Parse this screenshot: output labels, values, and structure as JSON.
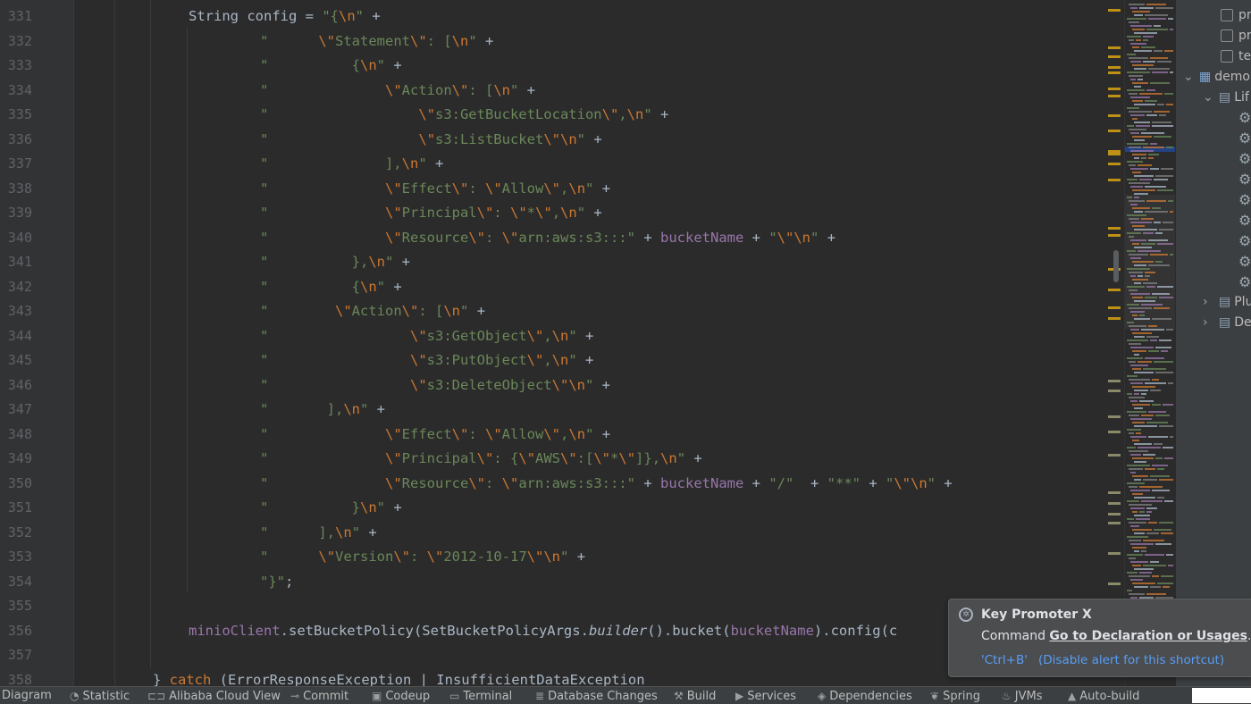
{
  "editor": {
    "lines": [
      {
        "n": "331",
        "segs": [
          [
            "",
            "String config = "
          ],
          [
            "str",
            "\"{"
          ],
          [
            "esc",
            "\\n"
          ],
          [
            "str",
            "\""
          ],
          [
            "",
            " +"
          ]
        ],
        "ind": 211
      },
      {
        "n": "332",
        "segs": [
          [
            "str",
            "\"      "
          ],
          [
            "esc",
            "\\\""
          ],
          [
            "str",
            "Statement"
          ],
          [
            "esc",
            "\\\""
          ],
          [
            "str",
            ": ["
          ],
          [
            "esc",
            "\\n"
          ],
          [
            "str",
            "\""
          ],
          [
            "",
            " +"
          ]
        ],
        "ind": 291
      },
      {
        "n": "333",
        "segs": [
          [
            "str",
            "\"          {"
          ],
          [
            "esc",
            "\\n"
          ],
          [
            "str",
            "\""
          ],
          [
            "",
            " +"
          ]
        ],
        "ind": 291
      },
      {
        "n": "334",
        "segs": [
          [
            "str",
            "\"              "
          ],
          [
            "esc",
            "\\\""
          ],
          [
            "str",
            "Action"
          ],
          [
            "esc",
            "\\\""
          ],
          [
            "str",
            ": ["
          ],
          [
            "esc",
            "\\n"
          ],
          [
            "str",
            "\""
          ],
          [
            "",
            " +"
          ]
        ],
        "ind": 291
      },
      {
        "n": "335",
        "segs": [
          [
            "str",
            "\"                  "
          ],
          [
            "esc",
            "\\\""
          ],
          [
            "str",
            "s3:GetBucketLocation"
          ],
          [
            "esc",
            "\\\""
          ],
          [
            "str",
            ","
          ],
          [
            "esc",
            "\\n"
          ],
          [
            "str",
            "\""
          ],
          [
            "",
            " +"
          ]
        ],
        "ind": 291
      },
      {
        "n": "336",
        "segs": [
          [
            "str",
            "\"                  "
          ],
          [
            "esc",
            "\\\""
          ],
          [
            "str",
            "s3:ListBucket"
          ],
          [
            "esc",
            "\\\""
          ],
          [
            "esc",
            "\\n"
          ],
          [
            "str",
            "\""
          ],
          [
            "",
            " +"
          ]
        ],
        "ind": 291
      },
      {
        "n": "337",
        "segs": [
          [
            "str",
            "\"              ],"
          ],
          [
            "esc",
            "\\n"
          ],
          [
            "str",
            "\""
          ],
          [
            "",
            " +"
          ]
        ],
        "ind": 291
      },
      {
        "n": "338",
        "segs": [
          [
            "str",
            "\"              "
          ],
          [
            "esc",
            "\\\""
          ],
          [
            "str",
            "Effect"
          ],
          [
            "esc",
            "\\\""
          ],
          [
            "str",
            ": "
          ],
          [
            "esc",
            "\\\""
          ],
          [
            "str",
            "Allow"
          ],
          [
            "esc",
            "\\\""
          ],
          [
            "str",
            ","
          ],
          [
            "esc",
            "\\n"
          ],
          [
            "str",
            "\""
          ],
          [
            "",
            " +"
          ]
        ],
        "ind": 291
      },
      {
        "n": "339",
        "segs": [
          [
            "str",
            "\"              "
          ],
          [
            "esc",
            "\\\""
          ],
          [
            "str",
            "Principal"
          ],
          [
            "esc",
            "\\\""
          ],
          [
            "str",
            ": "
          ],
          [
            "esc",
            "\\\""
          ],
          [
            "str",
            "*"
          ],
          [
            "esc",
            "\\\""
          ],
          [
            "str",
            ","
          ],
          [
            "esc",
            "\\n"
          ],
          [
            "str",
            "\""
          ],
          [
            "",
            " +"
          ]
        ],
        "ind": 291
      },
      {
        "n": "340",
        "segs": [
          [
            "str",
            "\"              "
          ],
          [
            "esc",
            "\\\""
          ],
          [
            "str",
            "Resource"
          ],
          [
            "esc",
            "\\\""
          ],
          [
            "str",
            ": "
          ],
          [
            "esc",
            "\\\""
          ],
          [
            "str",
            "arn:aws:s3:::"
          ],
          [
            "str",
            "\""
          ],
          [
            "",
            " + "
          ],
          [
            "fld",
            "bucketName"
          ],
          [
            "",
            " + "
          ],
          [
            "str",
            "\""
          ],
          [
            "esc",
            "\\\""
          ],
          [
            "esc",
            "\\n"
          ],
          [
            "str",
            "\""
          ],
          [
            "",
            " +"
          ]
        ],
        "ind": 291
      },
      {
        "n": "341",
        "segs": [
          [
            "str",
            "\"          },"
          ],
          [
            "esc",
            "\\n"
          ],
          [
            "str",
            "\""
          ],
          [
            "",
            " +"
          ]
        ],
        "ind": 291
      },
      {
        "n": "342",
        "segs": [
          [
            "str",
            "\"          {"
          ],
          [
            "esc",
            "\\n"
          ],
          [
            "str",
            "\""
          ],
          [
            "",
            " +"
          ]
        ],
        "ind": 291
      },
      {
        "n": "343",
        "segs": [
          [
            "str",
            "\"        "
          ],
          [
            "esc",
            "\\\""
          ],
          [
            "str",
            "Action"
          ],
          [
            "esc",
            "\\\""
          ],
          [
            "str",
            ": ["
          ],
          [
            "esc",
            "\\n"
          ],
          [
            "str",
            "\""
          ],
          [
            "",
            " +"
          ]
        ],
        "ind": 291
      },
      {
        "n": "344",
        "segs": [
          [
            "str",
            "\"                 "
          ],
          [
            "esc",
            "\\\""
          ],
          [
            "str",
            "s3:GetObject"
          ],
          [
            "esc",
            "\\\""
          ],
          [
            "str",
            ","
          ],
          [
            "esc",
            "\\n"
          ],
          [
            "str",
            "\""
          ],
          [
            "",
            " +"
          ]
        ],
        "ind": 291
      },
      {
        "n": "345",
        "segs": [
          [
            "str",
            "\"                 "
          ],
          [
            "esc",
            "\\\""
          ],
          [
            "str",
            "s3:PutObject"
          ],
          [
            "esc",
            "\\\""
          ],
          [
            "str",
            ","
          ],
          [
            "esc",
            "\\n"
          ],
          [
            "str",
            "\""
          ],
          [
            "",
            " +"
          ]
        ],
        "ind": 291
      },
      {
        "n": "346",
        "segs": [
          [
            "str",
            "\"                 "
          ],
          [
            "esc",
            "\\\""
          ],
          [
            "str",
            "s3:DeleteObject"
          ],
          [
            "esc",
            "\\\""
          ],
          [
            "esc",
            "\\n"
          ],
          [
            "str",
            "\""
          ],
          [
            "",
            " +"
          ]
        ],
        "ind": 291
      },
      {
        "n": "347",
        "segs": [
          [
            "str",
            "\"       ],"
          ],
          [
            "esc",
            "\\n"
          ],
          [
            "str",
            "\""
          ],
          [
            "",
            " +"
          ]
        ],
        "ind": 291
      },
      {
        "n": "348",
        "segs": [
          [
            "str",
            "\"              "
          ],
          [
            "esc",
            "\\\""
          ],
          [
            "str",
            "Effect"
          ],
          [
            "esc",
            "\\\""
          ],
          [
            "str",
            ": "
          ],
          [
            "esc",
            "\\\""
          ],
          [
            "str",
            "Allow"
          ],
          [
            "esc",
            "\\\""
          ],
          [
            "str",
            ","
          ],
          [
            "esc",
            "\\n"
          ],
          [
            "str",
            "\""
          ],
          [
            "",
            " +"
          ]
        ],
        "ind": 291
      },
      {
        "n": "349",
        "segs": [
          [
            "str",
            "\"              "
          ],
          [
            "esc",
            "\\\""
          ],
          [
            "str",
            "Principal"
          ],
          [
            "esc",
            "\\\""
          ],
          [
            "str",
            ": {"
          ],
          [
            "esc",
            "\\\""
          ],
          [
            "str",
            "AWS"
          ],
          [
            "esc",
            "\\\""
          ],
          [
            "str",
            ":["
          ],
          [
            "esc",
            "\\\""
          ],
          [
            "str",
            "*"
          ],
          [
            "esc",
            "\\\""
          ],
          [
            "str",
            "]},"
          ],
          [
            "esc",
            "\\n"
          ],
          [
            "str",
            "\""
          ],
          [
            "",
            " +"
          ]
        ],
        "ind": 291
      },
      {
        "n": "350",
        "segs": [
          [
            "str",
            "\"              "
          ],
          [
            "esc",
            "\\\""
          ],
          [
            "str",
            "Resource"
          ],
          [
            "esc",
            "\\\""
          ],
          [
            "str",
            ": "
          ],
          [
            "esc",
            "\\\""
          ],
          [
            "str",
            "arn:aws:s3:::"
          ],
          [
            "str",
            "\""
          ],
          [
            "",
            " + "
          ],
          [
            "fld",
            "bucketName"
          ],
          [
            "",
            " + "
          ],
          [
            "str",
            "\"/\""
          ],
          [
            "",
            "  + "
          ],
          [
            "str",
            "\"**\""
          ],
          [
            "",
            " + "
          ],
          [
            "str",
            "\""
          ],
          [
            "esc",
            "\\\""
          ],
          [
            "esc",
            "\\n"
          ],
          [
            "str",
            "\""
          ],
          [
            "",
            " +"
          ]
        ],
        "ind": 291
      },
      {
        "n": "351",
        "segs": [
          [
            "str",
            "\"          }"
          ],
          [
            "esc",
            "\\n"
          ],
          [
            "str",
            "\""
          ],
          [
            "",
            " +"
          ]
        ],
        "ind": 291
      },
      {
        "n": "352",
        "segs": [
          [
            "str",
            "\"      ],"
          ],
          [
            "esc",
            "\\n"
          ],
          [
            "str",
            "\""
          ],
          [
            "",
            " +"
          ]
        ],
        "ind": 291
      },
      {
        "n": "353",
        "segs": [
          [
            "str",
            "\"      "
          ],
          [
            "esc",
            "\\\""
          ],
          [
            "str",
            "Version"
          ],
          [
            "esc",
            "\\\""
          ],
          [
            "str",
            ": "
          ],
          [
            "esc",
            "\\\""
          ],
          [
            "str",
            "2012-10-17"
          ],
          [
            "esc",
            "\\\""
          ],
          [
            "esc",
            "\\n"
          ],
          [
            "str",
            "\""
          ],
          [
            "",
            " +"
          ]
        ],
        "ind": 291
      },
      {
        "n": "354",
        "segs": [
          [
            "str",
            "\"}\""
          ],
          [
            "",
            ";"
          ]
        ],
        "ind": 291
      },
      {
        "n": "355",
        "segs": [],
        "ind": 211
      },
      {
        "n": "356",
        "segs": [
          [
            "fld",
            "minioClient"
          ],
          [
            "",
            ".setBucketPolicy(SetBucketPolicyArgs."
          ],
          [
            "it",
            "builder"
          ],
          [
            "",
            "().bucket("
          ],
          [
            "fld",
            "bucketName"
          ],
          [
            "",
            ").config(c"
          ]
        ],
        "ind": 211
      },
      {
        "n": "357",
        "segs": [],
        "ind": 211
      },
      {
        "n": "358",
        "segs": [
          [
            "",
            "} "
          ],
          [
            "kw",
            "catch"
          ],
          [
            "",
            " (ErrorResponseException | InsufficientDataException"
          ]
        ],
        "ind": 171
      }
    ]
  },
  "project_tree": {
    "items": [
      {
        "label": "pr",
        "type": "checkbox"
      },
      {
        "label": "pr",
        "type": "checkbox"
      },
      {
        "label": "tes",
        "type": "checkbox"
      },
      {
        "label": "demo",
        "type": "module",
        "arrow": "⌄"
      },
      {
        "label": "Lif",
        "type": "folder",
        "arrow": "⌄"
      },
      {
        "label": "",
        "type": "gear"
      },
      {
        "label": "",
        "type": "gear"
      },
      {
        "label": "",
        "type": "gear"
      },
      {
        "label": "",
        "type": "gear"
      },
      {
        "label": "",
        "type": "gear"
      },
      {
        "label": "",
        "type": "gear"
      },
      {
        "label": "",
        "type": "gear"
      },
      {
        "label": "",
        "type": "gear"
      },
      {
        "label": "",
        "type": "gear"
      },
      {
        "label": "Plu",
        "type": "folder",
        "arrow": "›"
      },
      {
        "label": "De",
        "type": "folder",
        "arrow": "›"
      }
    ]
  },
  "notification": {
    "title": "Key Promoter X",
    "message_prefix": "Command ",
    "message_action": "Go to Declaration or Usages",
    "message_suffix": "...",
    "shortcut_link": "'Ctrl+B'",
    "disable_link": "(Disable alert for this shortcut)"
  },
  "statusbar": {
    "items": [
      {
        "label": "Diagram",
        "icon": ""
      },
      {
        "label": "Statistic",
        "icon": "◔"
      },
      {
        "label": "Alibaba Cloud View",
        "icon": "⊏⊐"
      },
      {
        "label": "Commit",
        "icon": "⊸"
      },
      {
        "label": "Codeup",
        "icon": "▣"
      },
      {
        "label": "Terminal",
        "icon": "▭"
      },
      {
        "label": "Database Changes",
        "icon": "≣"
      },
      {
        "label": "Build",
        "icon": "⚒"
      },
      {
        "label": "Services",
        "icon": "▶"
      },
      {
        "label": "Dependencies",
        "icon": "◈"
      },
      {
        "label": "Spring",
        "icon": "❦"
      },
      {
        "label": "JVMs",
        "icon": "♨"
      },
      {
        "label": "Auto-build",
        "icon": "▲"
      }
    ]
  },
  "colors": {
    "editor_bg": "#2b2b2b",
    "string": "#6a8759",
    "keyword": "#cc7832",
    "field": "#9876aa",
    "text": "#a9b7c6",
    "link": "#589df6"
  }
}
